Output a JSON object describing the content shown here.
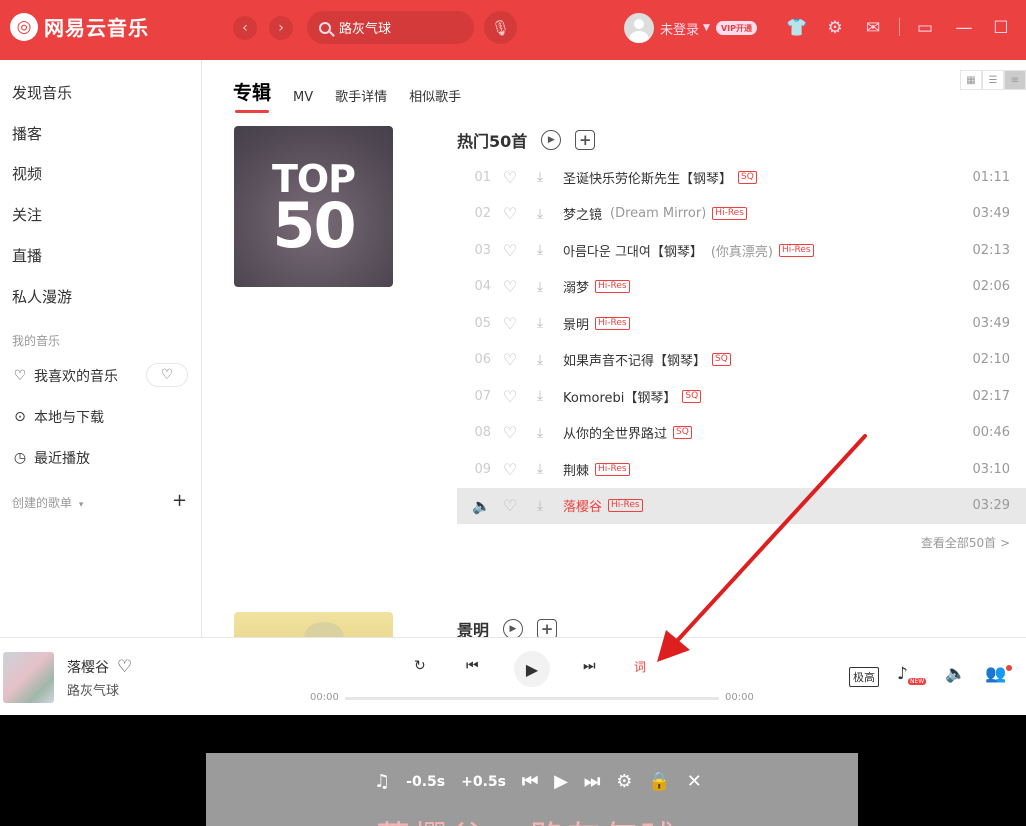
{
  "app": {
    "logo_glyph": "◎",
    "logo_text": "网易云音乐"
  },
  "header": {
    "search_value": "路灰气球",
    "user_name": "未登录",
    "vip_label": "VIP开通"
  },
  "sidebar": {
    "items": [
      "发现音乐",
      "播客",
      "视频",
      "关注",
      "直播",
      "私人漫游"
    ],
    "my_music_label": "我的音乐",
    "my_music": [
      {
        "icon": "♡",
        "label": "我喜欢的音乐"
      },
      {
        "icon": "⊙",
        "label": "本地与下载"
      },
      {
        "icon": "◷",
        "label": "最近播放"
      }
    ],
    "created_playlists_label": "创建的歌单",
    "created_caret": "▾"
  },
  "main": {
    "tabs": [
      "专辑",
      "MV",
      "歌手详情",
      "相似歌手"
    ],
    "cover": {
      "line1": "TOP",
      "line2": "50"
    },
    "section1_title": "热门50首",
    "section2_title": "景明",
    "see_all": "查看全部50首 >",
    "tracks": [
      {
        "num": "01",
        "title": "圣诞快乐劳伦斯先生【钢琴】",
        "alias": "",
        "badge": "SQ",
        "duration": "01:11"
      },
      {
        "num": "02",
        "title": "梦之镜",
        "alias": "(Dream Mirror)",
        "badge": "Hi-Res",
        "duration": "03:49"
      },
      {
        "num": "03",
        "title": "아름다운 그대여【钢琴】",
        "alias": "(你真漂亮)",
        "badge": "Hi-Res",
        "duration": "02:13"
      },
      {
        "num": "04",
        "title": "溺梦",
        "alias": "",
        "badge": "Hi-Res",
        "duration": "02:06"
      },
      {
        "num": "05",
        "title": "景明",
        "alias": "",
        "badge": "Hi-Res",
        "duration": "03:49"
      },
      {
        "num": "06",
        "title": "如果声音不记得【钢琴】",
        "alias": "",
        "badge": "SQ",
        "duration": "02:10"
      },
      {
        "num": "07",
        "title": "Komorebi【钢琴】",
        "alias": "",
        "badge": "SQ",
        "duration": "02:17"
      },
      {
        "num": "08",
        "title": "从你的全世界路过",
        "alias": "",
        "badge": "SQ",
        "duration": "00:46"
      },
      {
        "num": "09",
        "title": "荆棘",
        "alias": "",
        "badge": "Hi-Res",
        "duration": "03:10"
      },
      {
        "num": "",
        "title": "落樱谷",
        "alias": "",
        "badge": "Hi-Res",
        "duration": "03:29",
        "playing": true
      }
    ]
  },
  "player": {
    "song": "落樱谷",
    "artist": "路灰气球",
    "lyric_btn": "词",
    "time_current": "00:00",
    "time_total": "00:00",
    "quality": "极高",
    "new_badge": "NEW"
  },
  "lyric_panel": {
    "minus_label": "-0.5s",
    "plus_label": "+0.5s",
    "text": "落樱谷 - 路灰气球"
  },
  "colors": {
    "accent": "#ec4141"
  }
}
